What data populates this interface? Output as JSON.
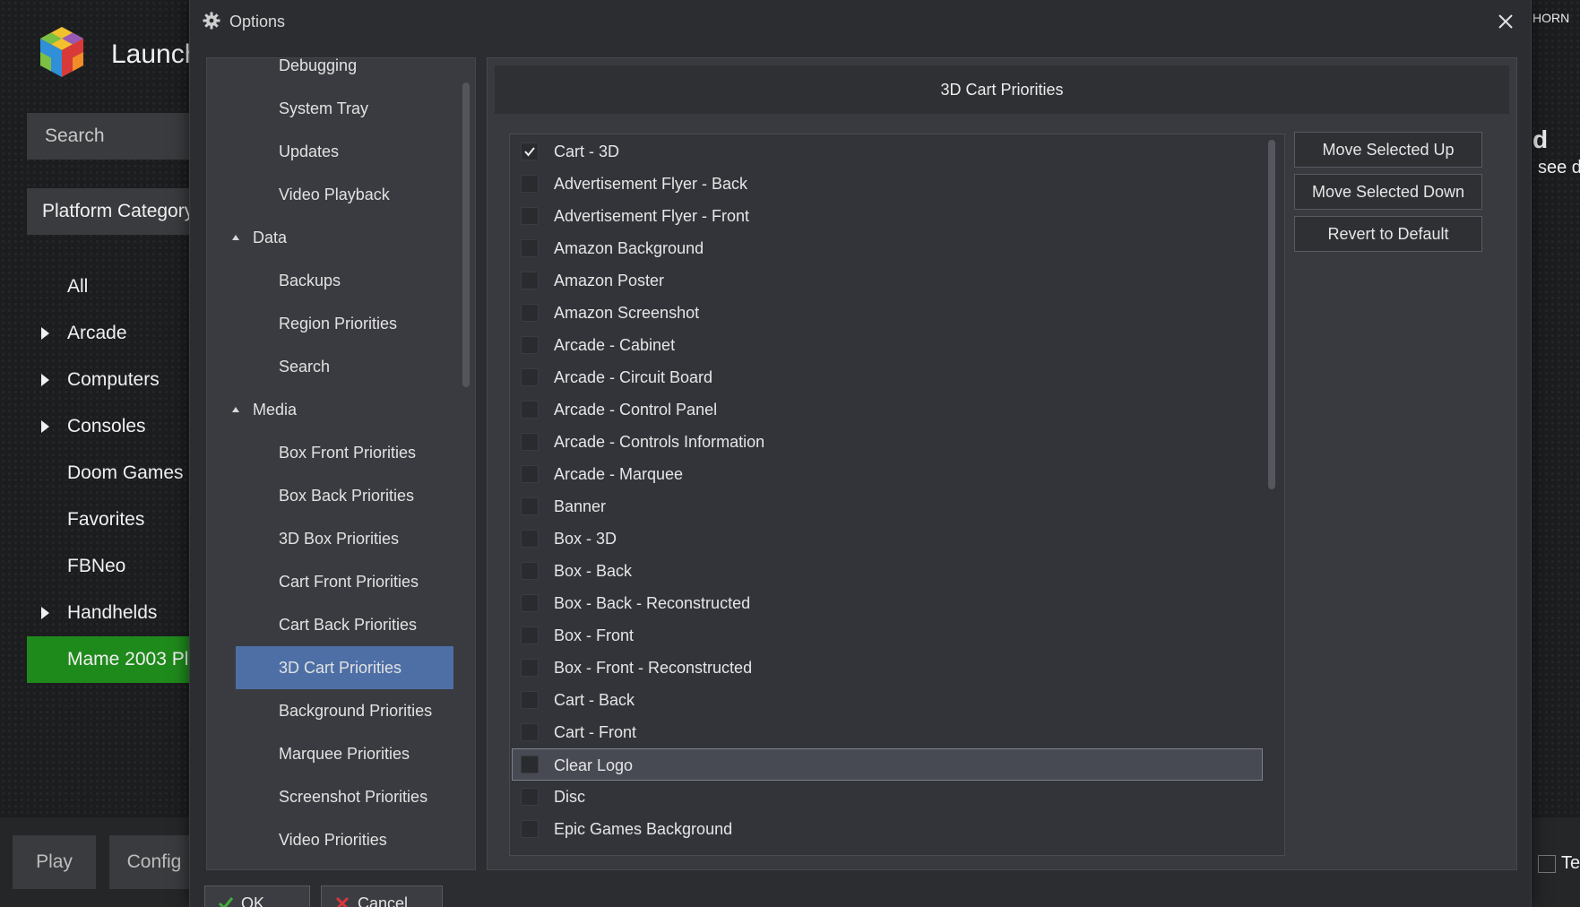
{
  "background": {
    "app_title": "Launch",
    "search_placeholder": "Search",
    "platform_category": "Platform Category",
    "nav": [
      {
        "label": "All",
        "expandable": false
      },
      {
        "label": "Arcade",
        "expandable": true
      },
      {
        "label": "Computers",
        "expandable": true
      },
      {
        "label": "Consoles",
        "expandable": true
      },
      {
        "label": "Doom Games",
        "expandable": false
      },
      {
        "label": "Favorites",
        "expandable": false
      },
      {
        "label": "FBNeo",
        "expandable": false
      },
      {
        "label": "Handhelds",
        "expandable": true
      },
      {
        "label": "Mame 2003 Pl",
        "expandable": false,
        "selected": true
      }
    ],
    "bottom_play": "Play",
    "bottom_config": "Config",
    "right_top": "HORN",
    "right_heading": "d",
    "right_sub": "see d",
    "right_bottom": "Te"
  },
  "dialog": {
    "title": "Options",
    "nav_items": [
      {
        "label": "Debugging",
        "type": "child"
      },
      {
        "label": "System Tray",
        "type": "child"
      },
      {
        "label": "Updates",
        "type": "child"
      },
      {
        "label": "Video Playback",
        "type": "child"
      },
      {
        "label": "Data",
        "type": "group"
      },
      {
        "label": "Backups",
        "type": "child"
      },
      {
        "label": "Region Priorities",
        "type": "child"
      },
      {
        "label": "Search",
        "type": "child"
      },
      {
        "label": "Media",
        "type": "group"
      },
      {
        "label": "Box Front Priorities",
        "type": "child"
      },
      {
        "label": "Box Back Priorities",
        "type": "child"
      },
      {
        "label": "3D Box Priorities",
        "type": "child"
      },
      {
        "label": "Cart Front Priorities",
        "type": "child"
      },
      {
        "label": "Cart Back Priorities",
        "type": "child"
      },
      {
        "label": "3D Cart Priorities",
        "type": "child",
        "selected": true
      },
      {
        "label": "Background Priorities",
        "type": "child"
      },
      {
        "label": "Marquee Priorities",
        "type": "child"
      },
      {
        "label": "Screenshot Priorities",
        "type": "child"
      },
      {
        "label": "Video Priorities",
        "type": "child"
      }
    ],
    "content_title": "3D Cart Priorities",
    "priority_items": [
      {
        "label": "Cart - 3D",
        "checked": true
      },
      {
        "label": "Advertisement Flyer - Back",
        "checked": false
      },
      {
        "label": "Advertisement Flyer - Front",
        "checked": false
      },
      {
        "label": "Amazon Background",
        "checked": false
      },
      {
        "label": "Amazon Poster",
        "checked": false
      },
      {
        "label": "Amazon Screenshot",
        "checked": false
      },
      {
        "label": "Arcade - Cabinet",
        "checked": false
      },
      {
        "label": "Arcade - Circuit Board",
        "checked": false
      },
      {
        "label": "Arcade - Control Panel",
        "checked": false
      },
      {
        "label": "Arcade - Controls Information",
        "checked": false
      },
      {
        "label": "Arcade - Marquee",
        "checked": false
      },
      {
        "label": "Banner",
        "checked": false
      },
      {
        "label": "Box - 3D",
        "checked": false
      },
      {
        "label": "Box - Back",
        "checked": false
      },
      {
        "label": "Box - Back - Reconstructed",
        "checked": false
      },
      {
        "label": "Box - Front",
        "checked": false
      },
      {
        "label": "Box - Front - Reconstructed",
        "checked": false
      },
      {
        "label": "Cart - Back",
        "checked": false
      },
      {
        "label": "Cart - Front",
        "checked": false
      },
      {
        "label": "Clear Logo",
        "checked": false,
        "hover": true
      },
      {
        "label": "Disc",
        "checked": false
      },
      {
        "label": "Epic Games Background",
        "checked": false
      }
    ],
    "buttons": {
      "move_up": "Move Selected Up",
      "move_down": "Move Selected Down",
      "revert": "Revert to Default"
    },
    "footer": {
      "ok": "OK",
      "cancel": "Cancel"
    }
  },
  "colors": {
    "selection_blue": "#4d6fa6",
    "selected_platform_green": "#1f8a1c",
    "ok_check_green": "#3fae3f",
    "cancel_x_red": "#d9363e"
  }
}
